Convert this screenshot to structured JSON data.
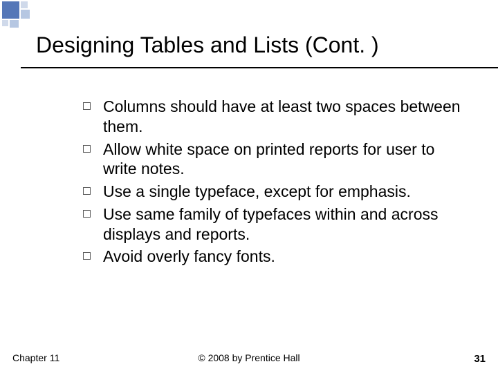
{
  "title": "Designing Tables and Lists (Cont. )",
  "bullets": [
    "Columns should have at least two spaces between them.",
    "Allow white space on printed reports for user to write notes.",
    "Use a single typeface, except for emphasis.",
    "Use same family of typefaces within and across displays and reports.",
    "Avoid overly fancy fonts."
  ],
  "footer": {
    "left": "Chapter 11",
    "center": "© 2008 by Prentice Hall",
    "pageNumber": "31"
  }
}
